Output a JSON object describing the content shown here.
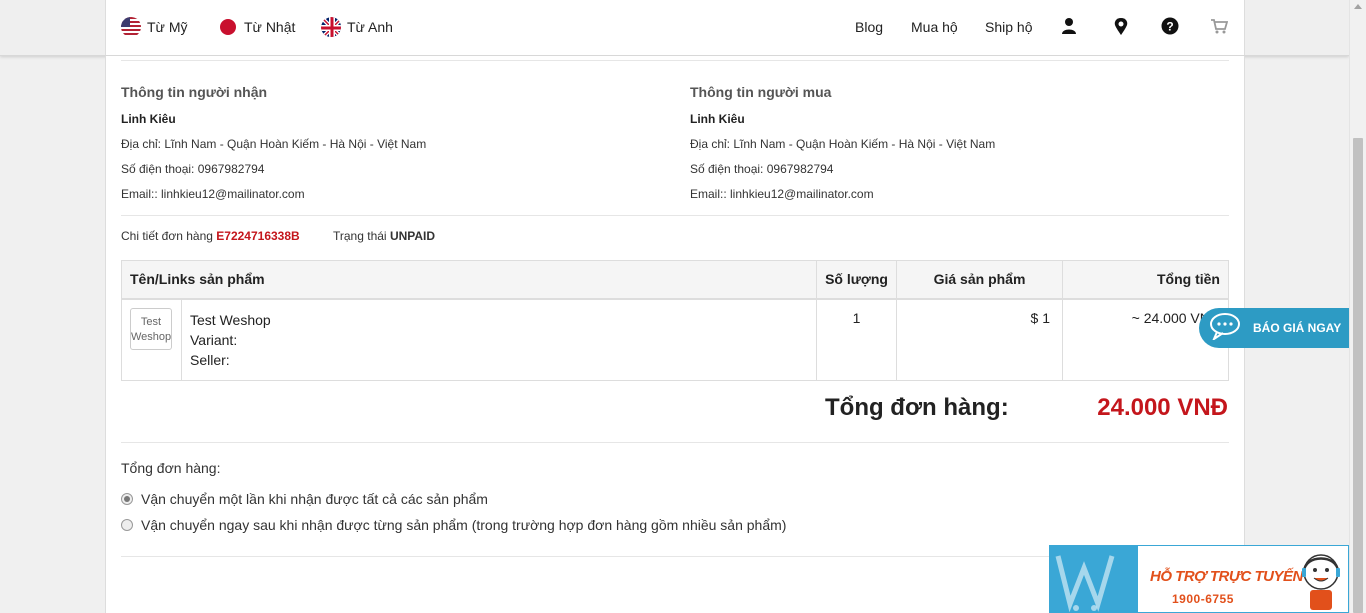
{
  "header": {
    "origins": [
      {
        "label": "Từ Mỹ",
        "icon": "us-flag-icon"
      },
      {
        "label": "Từ Nhật",
        "icon": "japan-flag-icon"
      },
      {
        "label": "Từ Anh",
        "icon": "uk-flag-icon"
      }
    ],
    "nav": [
      {
        "label": "Blog"
      },
      {
        "label": "Mua hộ"
      },
      {
        "label": "Ship hộ"
      }
    ],
    "icons": [
      "user-icon",
      "location-pin-icon",
      "help-icon",
      "cart-icon"
    ]
  },
  "recipient": {
    "title": "Thông tin người nhận",
    "name": "Linh Kiêu",
    "address": "Địa chỉ: Lĩnh Nam - Quận Hoàn Kiếm - Hà Nội - Việt Nam",
    "phone": "Số điện thoại: 0967982794",
    "email": "Email:: linhkieu12@mailinator.com"
  },
  "buyer": {
    "title": "Thông tin người mua",
    "name": "Linh Kiêu",
    "address": "Địa chỉ: Lĩnh Nam - Quận Hoàn Kiếm - Hà Nội - Việt Nam",
    "phone": "Số điện thoại: 0967982794",
    "email": "Email:: linhkieu12@mailinator.com"
  },
  "order": {
    "detail_label": "Chi tiết đơn hàng",
    "id": "E7224716338B",
    "status_label": "Trạng thái",
    "status": "UNPAID"
  },
  "table": {
    "headers": [
      "Tên/Links sản phẩm",
      "Số lượng",
      "Giá sản phẩm",
      "Tổng tiền"
    ],
    "rows": [
      {
        "image_alt": "Test Weshop",
        "name": "Test Weshop",
        "variant": "Variant:",
        "seller": "Seller:",
        "quantity": "1",
        "price": "$ 1",
        "total": "~ 24.000 VNĐ"
      }
    ]
  },
  "summary": {
    "label": "Tổng đơn hàng:",
    "value": "24.000 VNĐ"
  },
  "shipping": {
    "title": "Tổng đơn hàng:",
    "options": [
      {
        "label": "Vận chuyển một lần khi nhận được tất cả các sản phẩm",
        "checked": true
      },
      {
        "label": "Vận chuyển ngay sau khi nhận được từng sản phẩm (trong trường hợp đơn hàng gồm nhiều sản phẩm)",
        "checked": false
      }
    ]
  },
  "quote_button": {
    "label": "BÁO GIÁ NGAY"
  },
  "support": {
    "title": "HỖ TRỢ TRỰC TUYẾN",
    "phone": "1900-6755"
  },
  "colors": {
    "accent_red": "#c4161c",
    "quote_blue": "#2d9bc4",
    "support_orange": "#e2501b"
  }
}
